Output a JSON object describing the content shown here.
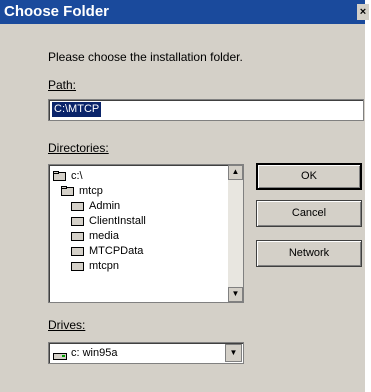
{
  "window": {
    "title": "Choose Folder",
    "close_glyph": "×"
  },
  "prompt": "Please choose the installation folder.",
  "path": {
    "label": "Path:",
    "value": "C:\\MTCP"
  },
  "directories": {
    "label": "Directories:",
    "items": [
      {
        "label": "c:\\",
        "icon": "open-folder-icon"
      },
      {
        "label": "mtcp",
        "icon": "open-folder-icon"
      },
      {
        "label": "Admin",
        "icon": "folder-icon"
      },
      {
        "label": "ClientInstall",
        "icon": "folder-icon"
      },
      {
        "label": "media",
        "icon": "folder-icon"
      },
      {
        "label": "MTCPData",
        "icon": "folder-icon"
      },
      {
        "label": "mtcpn",
        "icon": "folder-icon"
      }
    ]
  },
  "buttons": {
    "ok": "OK",
    "cancel": "Cancel",
    "network": "Network"
  },
  "drives": {
    "label": "Drives:",
    "selected": "c: win95a",
    "icon": "drive-icon"
  },
  "scroll_glyphs": {
    "up": "▲",
    "down": "▼"
  },
  "colors": {
    "titlebar": "#1a4a9c",
    "dialog_bg": "#d4d0c8",
    "selection": "#0a246a"
  }
}
